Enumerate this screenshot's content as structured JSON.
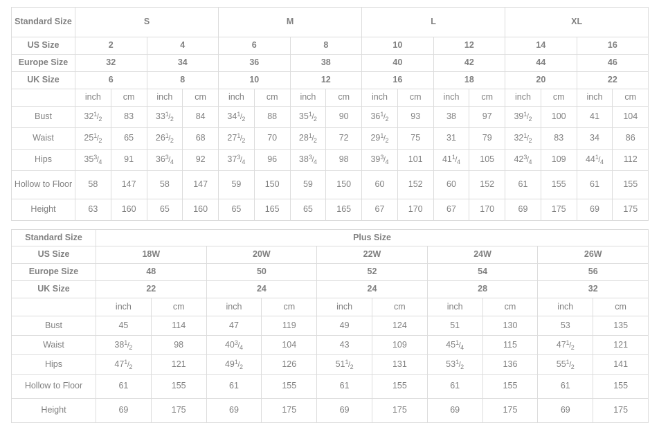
{
  "colors": {
    "header_bg": "#efefef",
    "border": "#dcdcdc",
    "header_text": "#1a1a1a",
    "body_text": "#8a8a8a",
    "page_bg": "#ffffff"
  },
  "standard_table": {
    "corner_label": "Standard Size",
    "row_labels": {
      "us": "US Size",
      "europe": "Europe Size",
      "uk": "UK Size"
    },
    "groups": [
      {
        "label": "S",
        "cols": 2
      },
      {
        "label": "M",
        "cols": 2
      },
      {
        "label": "L",
        "cols": 2
      },
      {
        "label": "XL",
        "cols": 2
      }
    ],
    "us_sizes": [
      "2",
      "4",
      "6",
      "8",
      "10",
      "12",
      "14",
      "16"
    ],
    "europe_sizes": [
      "32",
      "34",
      "36",
      "38",
      "40",
      "42",
      "44",
      "46"
    ],
    "uk_sizes": [
      "6",
      "8",
      "10",
      "12",
      "16",
      "18",
      "20",
      "22"
    ],
    "unit_inch": "inch",
    "unit_cm": "cm",
    "measure_rows": [
      {
        "label": "Bust",
        "two_line": false,
        "values": [
          {
            "whole": "32",
            "num": "1",
            "den": "2"
          },
          {
            "whole": "83"
          },
          {
            "whole": "33",
            "num": "1",
            "den": "2"
          },
          {
            "whole": "84"
          },
          {
            "whole": "34",
            "num": "1",
            "den": "2"
          },
          {
            "whole": "88"
          },
          {
            "whole": "35",
            "num": "1",
            "den": "2"
          },
          {
            "whole": "90"
          },
          {
            "whole": "36",
            "num": "1",
            "den": "2"
          },
          {
            "whole": "93"
          },
          {
            "whole": "38"
          },
          {
            "whole": "97"
          },
          {
            "whole": "39",
            "num": "1",
            "den": "2"
          },
          {
            "whole": "100"
          },
          {
            "whole": "41"
          },
          {
            "whole": "104"
          }
        ]
      },
      {
        "label": "Waist",
        "two_line": false,
        "values": [
          {
            "whole": "25",
            "num": "1",
            "den": "2"
          },
          {
            "whole": "65"
          },
          {
            "whole": "26",
            "num": "1",
            "den": "2"
          },
          {
            "whole": "68"
          },
          {
            "whole": "27",
            "num": "1",
            "den": "2"
          },
          {
            "whole": "70"
          },
          {
            "whole": "28",
            "num": "1",
            "den": "2"
          },
          {
            "whole": "72"
          },
          {
            "whole": "29",
            "num": "1",
            "den": "2"
          },
          {
            "whole": "75"
          },
          {
            "whole": "31"
          },
          {
            "whole": "79"
          },
          {
            "whole": "32",
            "num": "1",
            "den": "2"
          },
          {
            "whole": "83"
          },
          {
            "whole": "34"
          },
          {
            "whole": "86"
          }
        ]
      },
      {
        "label": "Hips",
        "two_line": false,
        "values": [
          {
            "whole": "35",
            "num": "3",
            "den": "4"
          },
          {
            "whole": "91"
          },
          {
            "whole": "36",
            "num": "3",
            "den": "4"
          },
          {
            "whole": "92"
          },
          {
            "whole": "37",
            "num": "3",
            "den": "4"
          },
          {
            "whole": "96"
          },
          {
            "whole": "38",
            "num": "3",
            "den": "4"
          },
          {
            "whole": "98"
          },
          {
            "whole": "39",
            "num": "3",
            "den": "4"
          },
          {
            "whole": "101"
          },
          {
            "whole": "41",
            "num": "1",
            "den": "4"
          },
          {
            "whole": "105"
          },
          {
            "whole": "42",
            "num": "3",
            "den": "4"
          },
          {
            "whole": "109"
          },
          {
            "whole": "44",
            "num": "1",
            "den": "4"
          },
          {
            "whole": "112"
          }
        ]
      },
      {
        "label": "Hollow to Floor",
        "two_line": true,
        "values": [
          {
            "whole": "58"
          },
          {
            "whole": "147"
          },
          {
            "whole": "58"
          },
          {
            "whole": "147"
          },
          {
            "whole": "59"
          },
          {
            "whole": "150"
          },
          {
            "whole": "59"
          },
          {
            "whole": "150"
          },
          {
            "whole": "60"
          },
          {
            "whole": "152"
          },
          {
            "whole": "60"
          },
          {
            "whole": "152"
          },
          {
            "whole": "61"
          },
          {
            "whole": "155"
          },
          {
            "whole": "61"
          },
          {
            "whole": "155"
          }
        ]
      },
      {
        "label": "Height",
        "two_line": false,
        "values": [
          {
            "whole": "63"
          },
          {
            "whole": "160"
          },
          {
            "whole": "65"
          },
          {
            "whole": "160"
          },
          {
            "whole": "65"
          },
          {
            "whole": "165"
          },
          {
            "whole": "65"
          },
          {
            "whole": "165"
          },
          {
            "whole": "67"
          },
          {
            "whole": "170"
          },
          {
            "whole": "67"
          },
          {
            "whole": "170"
          },
          {
            "whole": "69"
          },
          {
            "whole": "175"
          },
          {
            "whole": "69"
          },
          {
            "whole": "175"
          }
        ]
      }
    ]
  },
  "plus_table": {
    "corner_label": "Standard Size",
    "group_label": "Plus Size",
    "row_labels": {
      "us": "US Size",
      "europe": "Europe Size",
      "uk": "UK Size"
    },
    "us_sizes": [
      "18W",
      "20W",
      "22W",
      "24W",
      "26W"
    ],
    "europe_sizes": [
      "48",
      "50",
      "52",
      "54",
      "56"
    ],
    "uk_sizes": [
      "22",
      "24",
      "24",
      "28",
      "32"
    ],
    "unit_inch": "inch",
    "unit_cm": "cm",
    "measure_rows": [
      {
        "label": "Bust",
        "values": [
          {
            "whole": "45"
          },
          {
            "whole": "114"
          },
          {
            "whole": "47"
          },
          {
            "whole": "119"
          },
          {
            "whole": "49"
          },
          {
            "whole": "124"
          },
          {
            "whole": "51"
          },
          {
            "whole": "130"
          },
          {
            "whole": "53"
          },
          {
            "whole": "135"
          }
        ]
      },
      {
        "label": "Waist",
        "values": [
          {
            "whole": "38",
            "num": "1",
            "den": "2"
          },
          {
            "whole": "98"
          },
          {
            "whole": "40",
            "num": "3",
            "den": "4"
          },
          {
            "whole": "104"
          },
          {
            "whole": "43"
          },
          {
            "whole": "109"
          },
          {
            "whole": "45",
            "num": "1",
            "den": "4"
          },
          {
            "whole": "115"
          },
          {
            "whole": "47",
            "num": "1",
            "den": "2"
          },
          {
            "whole": "121"
          }
        ]
      },
      {
        "label": "Hips",
        "values": [
          {
            "whole": "47",
            "num": "1",
            "den": "2"
          },
          {
            "whole": "121"
          },
          {
            "whole": "49",
            "num": "1",
            "den": "2"
          },
          {
            "whole": "126"
          },
          {
            "whole": "51",
            "num": "1",
            "den": "2"
          },
          {
            "whole": "131"
          },
          {
            "whole": "53",
            "num": "1",
            "den": "2"
          },
          {
            "whole": "136"
          },
          {
            "whole": "55",
            "num": "1",
            "den": "2"
          },
          {
            "whole": "141"
          }
        ]
      },
      {
        "label": "Hollow to Floor",
        "values": [
          {
            "whole": "61"
          },
          {
            "whole": "155"
          },
          {
            "whole": "61"
          },
          {
            "whole": "155"
          },
          {
            "whole": "61"
          },
          {
            "whole": "155"
          },
          {
            "whole": "61"
          },
          {
            "whole": "155"
          },
          {
            "whole": "61"
          },
          {
            "whole": "155"
          }
        ]
      },
      {
        "label": "Height",
        "values": [
          {
            "whole": "69"
          },
          {
            "whole": "175"
          },
          {
            "whole": "69"
          },
          {
            "whole": "175"
          },
          {
            "whole": "69"
          },
          {
            "whole": "175"
          },
          {
            "whole": "69"
          },
          {
            "whole": "175"
          },
          {
            "whole": "69"
          },
          {
            "whole": "175"
          }
        ]
      }
    ]
  }
}
